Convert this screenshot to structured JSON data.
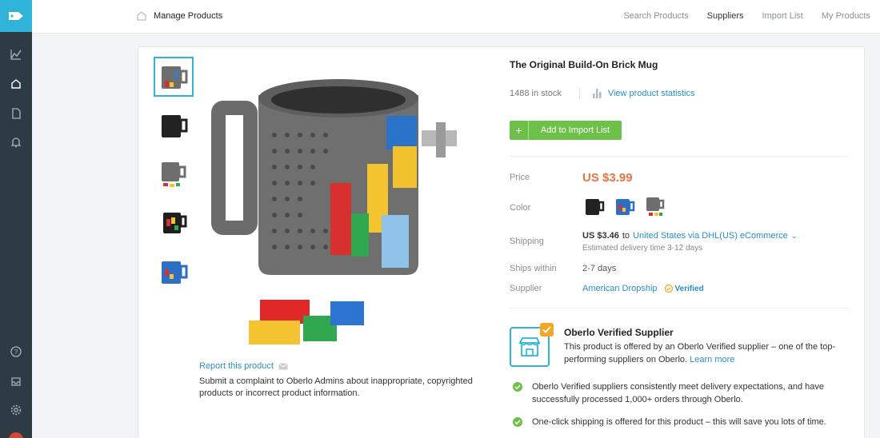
{
  "app": {
    "accent": "#2fb3d9",
    "sidebar_bg": "#2d3b45"
  },
  "sidebar": {
    "items": [
      {
        "icon": "analytics-icon"
      },
      {
        "icon": "store-icon"
      },
      {
        "icon": "orders-icon"
      },
      {
        "icon": "notifications-icon"
      },
      {
        "icon": "help-icon"
      },
      {
        "icon": "inbox-icon"
      },
      {
        "icon": "settings-icon"
      }
    ]
  },
  "topbar": {
    "breadcrumb": "Manage Products",
    "nav": [
      {
        "label": "Search Products",
        "active": false
      },
      {
        "label": "Suppliers",
        "active": true
      },
      {
        "label": "Import List",
        "active": false
      },
      {
        "label": "My Products",
        "active": false
      }
    ]
  },
  "product": {
    "title": "The Original Build-On Brick Mug",
    "stock": "1488 in stock",
    "stats_link": "View product statistics",
    "add_button": "Add to Import List",
    "thumbnails_count": 5,
    "report": {
      "link": "Report this product",
      "description": "Submit a complaint to Oberlo Admins about inappropriate, copyrighted products or incorrect product information."
    },
    "details": {
      "price_label": "Price",
      "price": "US $3.99",
      "color_label": "Color",
      "colors": [
        "black",
        "blue",
        "gray"
      ],
      "shipping_label": "Shipping",
      "shipping_cost": "US $3.46",
      "shipping_to": "to",
      "shipping_method": "United States via DHL(US) eCommerce",
      "delivery": "Estimated delivery time 3-12 days",
      "ships_within_label": "Ships within",
      "ships_within": "2-7 days",
      "supplier_label": "Supplier",
      "supplier_name": "American Dropship",
      "verified": "Verified"
    }
  },
  "verified_box": {
    "title": "Oberlo Verified Supplier",
    "description": "This product is offered by an Oberlo Verified supplier – one of the top-performing suppliers on Oberlo.",
    "learn_more": "Learn more",
    "bullets": [
      "Oberlo Verified suppliers consistently meet delivery expectations, and have successfully processed 1,000+ orders through Oberlo.",
      "One-click shipping is offered for this product – this will save you lots of time."
    ]
  }
}
